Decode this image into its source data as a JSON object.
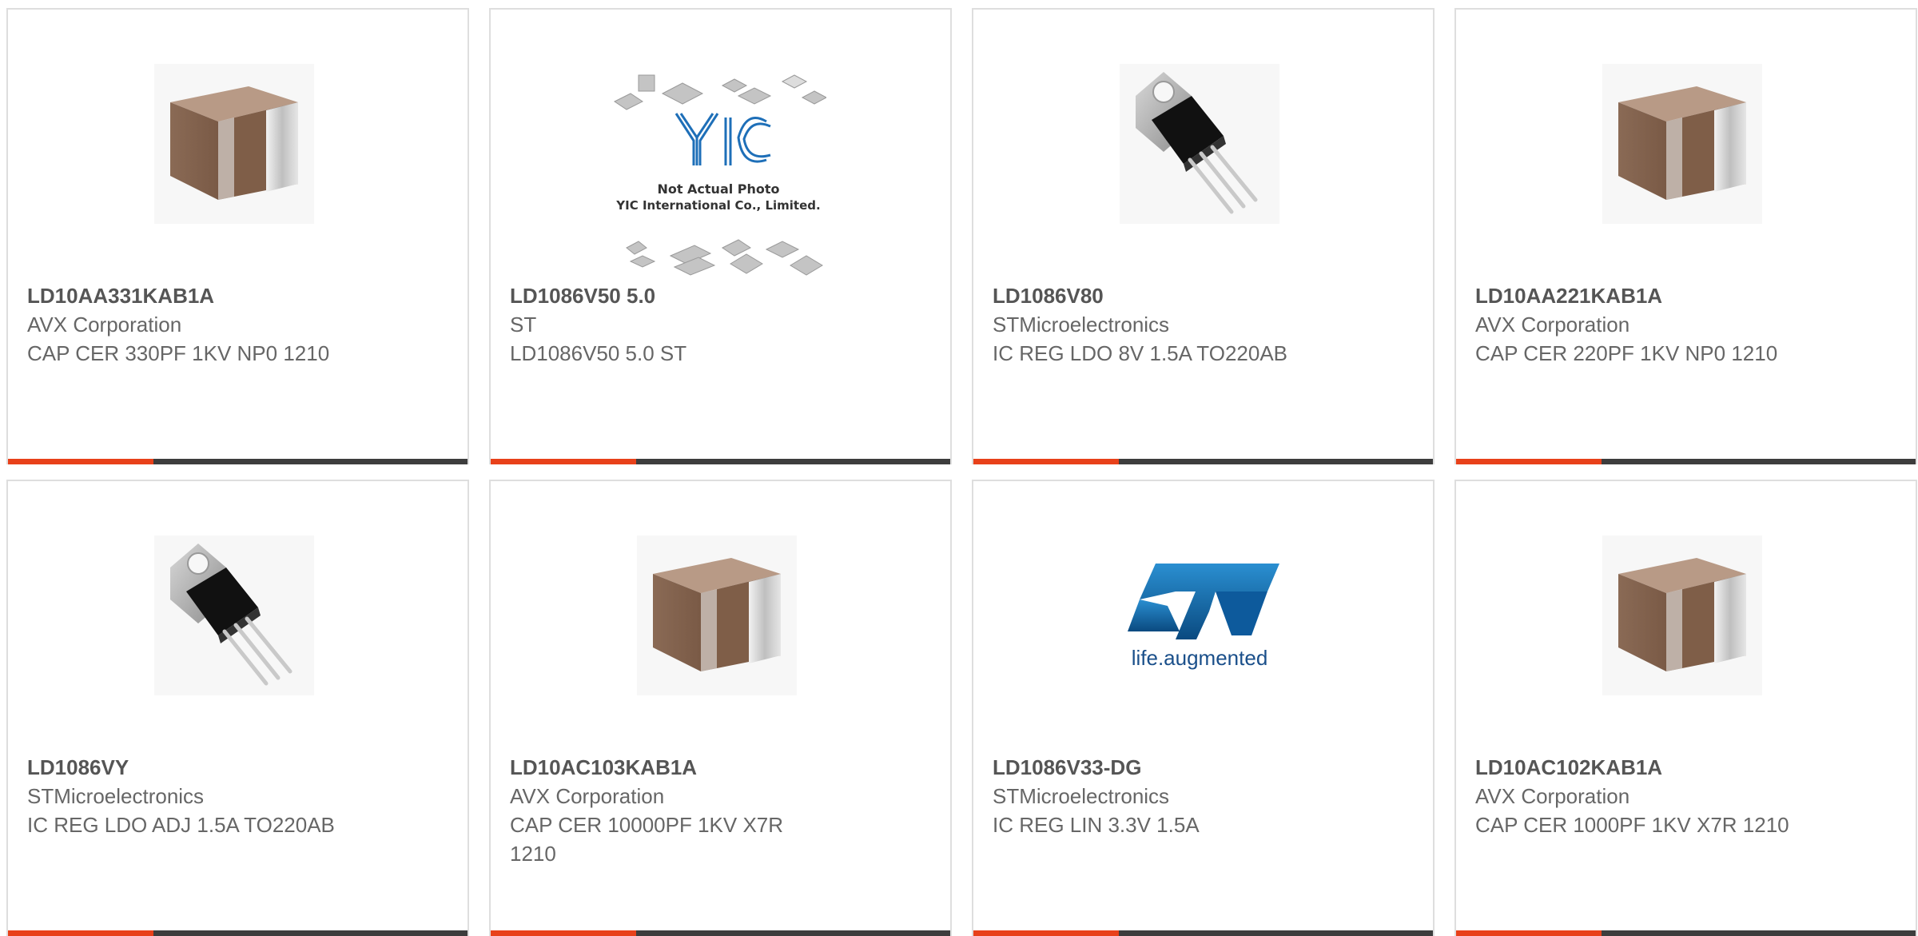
{
  "colors": {
    "accent": "#e8411a",
    "bar": "#3d3d3d",
    "card_border": "#dedede",
    "part_text": "#555555",
    "body_text": "#666666"
  },
  "products": [
    {
      "part": "LD10AA331KAB1A",
      "manufacturer": "AVX Corporation",
      "description": "CAP CER 330PF 1KV NP0 1210",
      "image": "ceramic-capacitor-icon"
    },
    {
      "part": "LD1086V50 5.0",
      "manufacturer": "ST",
      "description": "LD1086V50 5.0 ST",
      "image": "placeholder-image",
      "image_text": [
        "YIC",
        "Not Actual Photo",
        "YIC International Co., Limited."
      ]
    },
    {
      "part": "LD1086V80",
      "manufacturer": "STMicroelectronics",
      "description": "IC REG LDO 8V 1.5A TO220AB",
      "image": "to220-regulator-icon"
    },
    {
      "part": "LD10AA221KAB1A",
      "manufacturer": "AVX Corporation",
      "description": "CAP CER 220PF 1KV NP0 1210",
      "image": "ceramic-capacitor-icon"
    },
    {
      "part": "LD1086VY",
      "manufacturer": "STMicroelectronics",
      "description": "IC REG LDO ADJ 1.5A TO220AB",
      "image": "to220-regulator-icon"
    },
    {
      "part": "LD10AC103KAB1A",
      "manufacturer": "AVX Corporation",
      "description": "CAP CER 10000PF 1KV X7R 1210",
      "image": "ceramic-capacitor-icon"
    },
    {
      "part": "LD1086V33-DG",
      "manufacturer": "STMicroelectronics",
      "description": "IC REG LIN 3.3V 1.5A",
      "image": "st-logo",
      "image_text": [
        "life.augmented"
      ]
    },
    {
      "part": "LD10AC102KAB1A",
      "manufacturer": "AVX Corporation",
      "description": "CAP CER 1000PF 1KV X7R 1210",
      "image": "ceramic-capacitor-icon"
    }
  ]
}
